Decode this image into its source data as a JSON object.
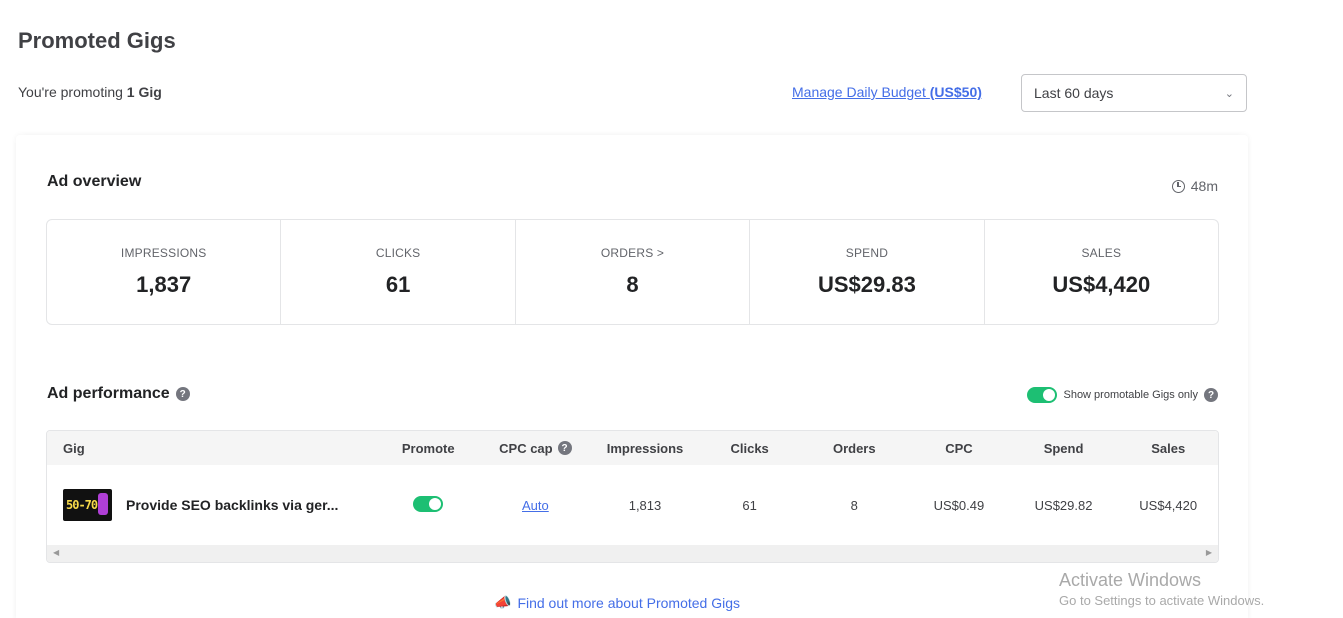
{
  "page": {
    "title": "Promoted Gigs",
    "promoting_prefix": "You're promoting",
    "promoting_count": "1 Gig",
    "budget_link_text": "Manage Daily Budget",
    "budget_amount": "(US$50)",
    "date_range": "Last 60 days"
  },
  "overview": {
    "title": "Ad overview",
    "timer": "48m",
    "stats": [
      {
        "label": "IMPRESSIONS",
        "value": "1,837"
      },
      {
        "label": "CLICKS",
        "value": "61"
      },
      {
        "label": "ORDERS >",
        "value": "8"
      },
      {
        "label": "SPEND",
        "value": "US$29.83"
      },
      {
        "label": "SALES",
        "value": "US$4,420"
      }
    ]
  },
  "performance": {
    "title": "Ad performance",
    "filter_label": "Show promotable Gigs only",
    "columns": [
      "Gig",
      "Promote",
      "CPC cap",
      "Impressions",
      "Clicks",
      "Orders",
      "CPC",
      "Spend",
      "Sales"
    ],
    "rows": [
      {
        "thumb_text": "50-70",
        "gig": "Provide SEO backlinks via ger...",
        "cpc_cap": "Auto",
        "impressions": "1,813",
        "clicks": "61",
        "orders": "8",
        "cpc": "US$0.49",
        "spend": "US$29.82",
        "sales": "US$4,420"
      }
    ]
  },
  "footer": {
    "find_more": "Find out more about Promoted Gigs"
  },
  "watermark": {
    "title": "Activate Windows",
    "subtitle": "Go to Settings to activate Windows."
  },
  "colors": {
    "accent_green": "#1dbf73",
    "link_blue": "#446ee7"
  }
}
